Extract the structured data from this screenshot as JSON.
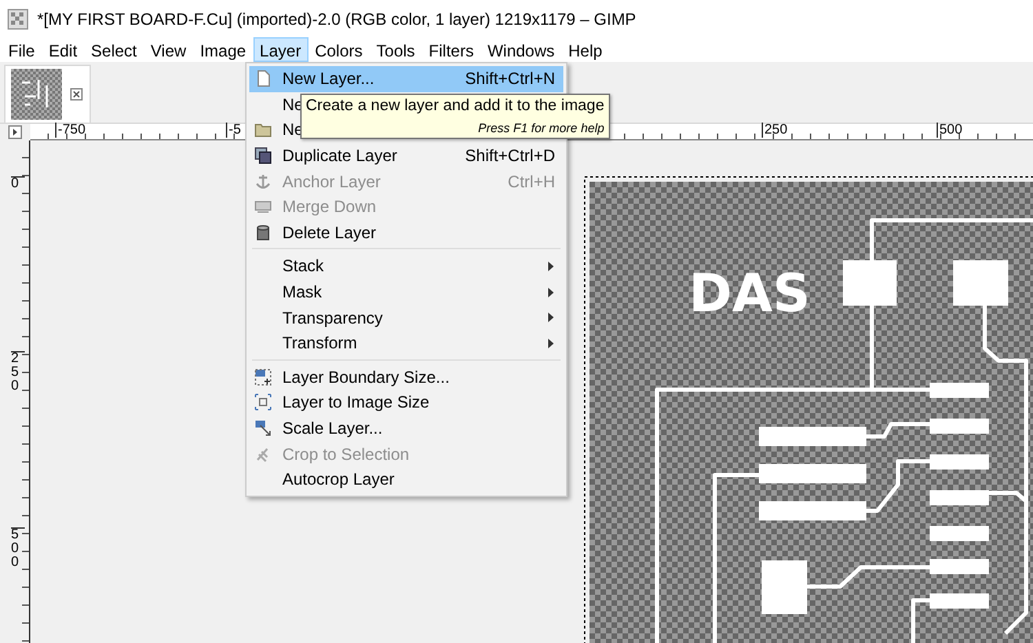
{
  "window": {
    "title": "*[MY FIRST BOARD-F.Cu] (imported)-2.0 (RGB color, 1 layer) 1219x1179 – GIMP"
  },
  "menu_bar": [
    {
      "label": "File",
      "selected": false
    },
    {
      "label": "Edit",
      "selected": false
    },
    {
      "label": "Select",
      "selected": false
    },
    {
      "label": "View",
      "selected": false
    },
    {
      "label": "Image",
      "selected": false
    },
    {
      "label": "Layer",
      "selected": true
    },
    {
      "label": "Colors",
      "selected": false
    },
    {
      "label": "Tools",
      "selected": false
    },
    {
      "label": "Filters",
      "selected": false
    },
    {
      "label": "Windows",
      "selected": false
    },
    {
      "label": "Help",
      "selected": false
    }
  ],
  "layer_menu": [
    {
      "kind": "item",
      "label": "New Layer...",
      "shortcut": "Shift+Ctrl+N",
      "selected": true,
      "disabled": false
    },
    {
      "kind": "item",
      "label": "Ne",
      "selected": false,
      "disabled": false
    },
    {
      "kind": "item",
      "label": "Ne",
      "selected": false,
      "disabled": false
    },
    {
      "kind": "item",
      "label": "Duplicate Layer",
      "shortcut": "Shift+Ctrl+D",
      "selected": false,
      "disabled": false
    },
    {
      "kind": "item",
      "label": "Anchor Layer",
      "shortcut": "Ctrl+H",
      "selected": false,
      "disabled": true
    },
    {
      "kind": "item",
      "label": "Merge Down",
      "selected": false,
      "disabled": true
    },
    {
      "kind": "item",
      "label": "Delete Layer",
      "selected": false,
      "disabled": false
    },
    {
      "kind": "separator"
    },
    {
      "kind": "submenu",
      "label": "Stack",
      "selected": false,
      "disabled": false
    },
    {
      "kind": "submenu",
      "label": "Mask",
      "selected": false,
      "disabled": false
    },
    {
      "kind": "submenu",
      "label": "Transparency",
      "selected": false,
      "disabled": false
    },
    {
      "kind": "submenu",
      "label": "Transform",
      "selected": false,
      "disabled": false
    },
    {
      "kind": "separator"
    },
    {
      "kind": "item",
      "label": "Layer Boundary Size...",
      "selected": false,
      "disabled": false
    },
    {
      "kind": "item",
      "label": "Layer to Image Size",
      "selected": false,
      "disabled": false
    },
    {
      "kind": "item",
      "label": "Scale Layer...",
      "selected": false,
      "disabled": false
    },
    {
      "kind": "item",
      "label": "Crop to Selection",
      "selected": false,
      "disabled": true
    },
    {
      "kind": "item",
      "label": "Autocrop Layer",
      "selected": false,
      "disabled": false
    }
  ],
  "tooltip": {
    "text": "Create a new layer and add it to the image",
    "hint": "Press F1 for more help"
  },
  "rulers": {
    "horizontal": [
      "-750",
      "-5",
      "250",
      "500"
    ],
    "vertical": [
      "0",
      "250",
      "500"
    ]
  },
  "canvas": {
    "board_text": "DAS"
  }
}
